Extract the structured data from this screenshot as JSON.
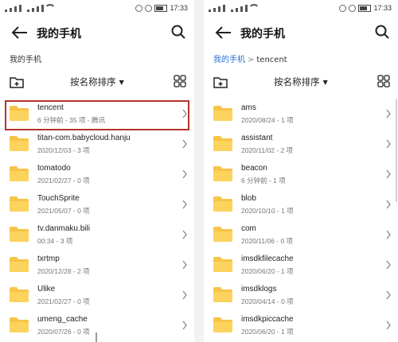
{
  "colors": {
    "accent": "#2a6fd6",
    "folder": "#f7c447",
    "highlight": "#b5332d"
  },
  "status_bar": {
    "time": "17:33"
  },
  "left": {
    "title": "我的手机",
    "breadcrumb": "我的手机",
    "sort_label": "按名称排序",
    "items": [
      {
        "name": "tencent",
        "meta": "6 分钟前 - 35 项 - 腾讯"
      },
      {
        "name": "titan-com.babycloud.hanju",
        "meta": "2020/12/03 - 3 项"
      },
      {
        "name": "tomatodo",
        "meta": "2021/02/27 - 0 项"
      },
      {
        "name": "TouchSprite",
        "meta": "2021/05/07 - 0 项"
      },
      {
        "name": "tv.danmaku.bili",
        "meta": "00:34 - 3 项"
      },
      {
        "name": "txrtmp",
        "meta": "2020/12/28 - 2 项"
      },
      {
        "name": "Ulike",
        "meta": "2021/02/27 - 0 项"
      },
      {
        "name": "umeng_cache",
        "meta": "2020/07/26 - 0 项"
      }
    ]
  },
  "right": {
    "title": "我的手机",
    "breadcrumb_root": "我的手机",
    "breadcrumb_current": "tencent",
    "sort_label": "按名称排序",
    "items": [
      {
        "name": "ams",
        "meta": "2020/08/24 - 1 项"
      },
      {
        "name": "assistant",
        "meta": "2020/11/02 - 2 项"
      },
      {
        "name": "beacon",
        "meta": "6 分钟前 - 1 项"
      },
      {
        "name": "blob",
        "meta": "2020/10/10 - 1 项"
      },
      {
        "name": "com",
        "meta": "2020/11/06 - 0 项"
      },
      {
        "name": "imsdkfilecache",
        "meta": "2020/06/20 - 1 项"
      },
      {
        "name": "imsdklogs",
        "meta": "2020/04/14 - 0 项"
      },
      {
        "name": "imsdkpiccache",
        "meta": "2020/06/20 - 1 项"
      }
    ]
  }
}
